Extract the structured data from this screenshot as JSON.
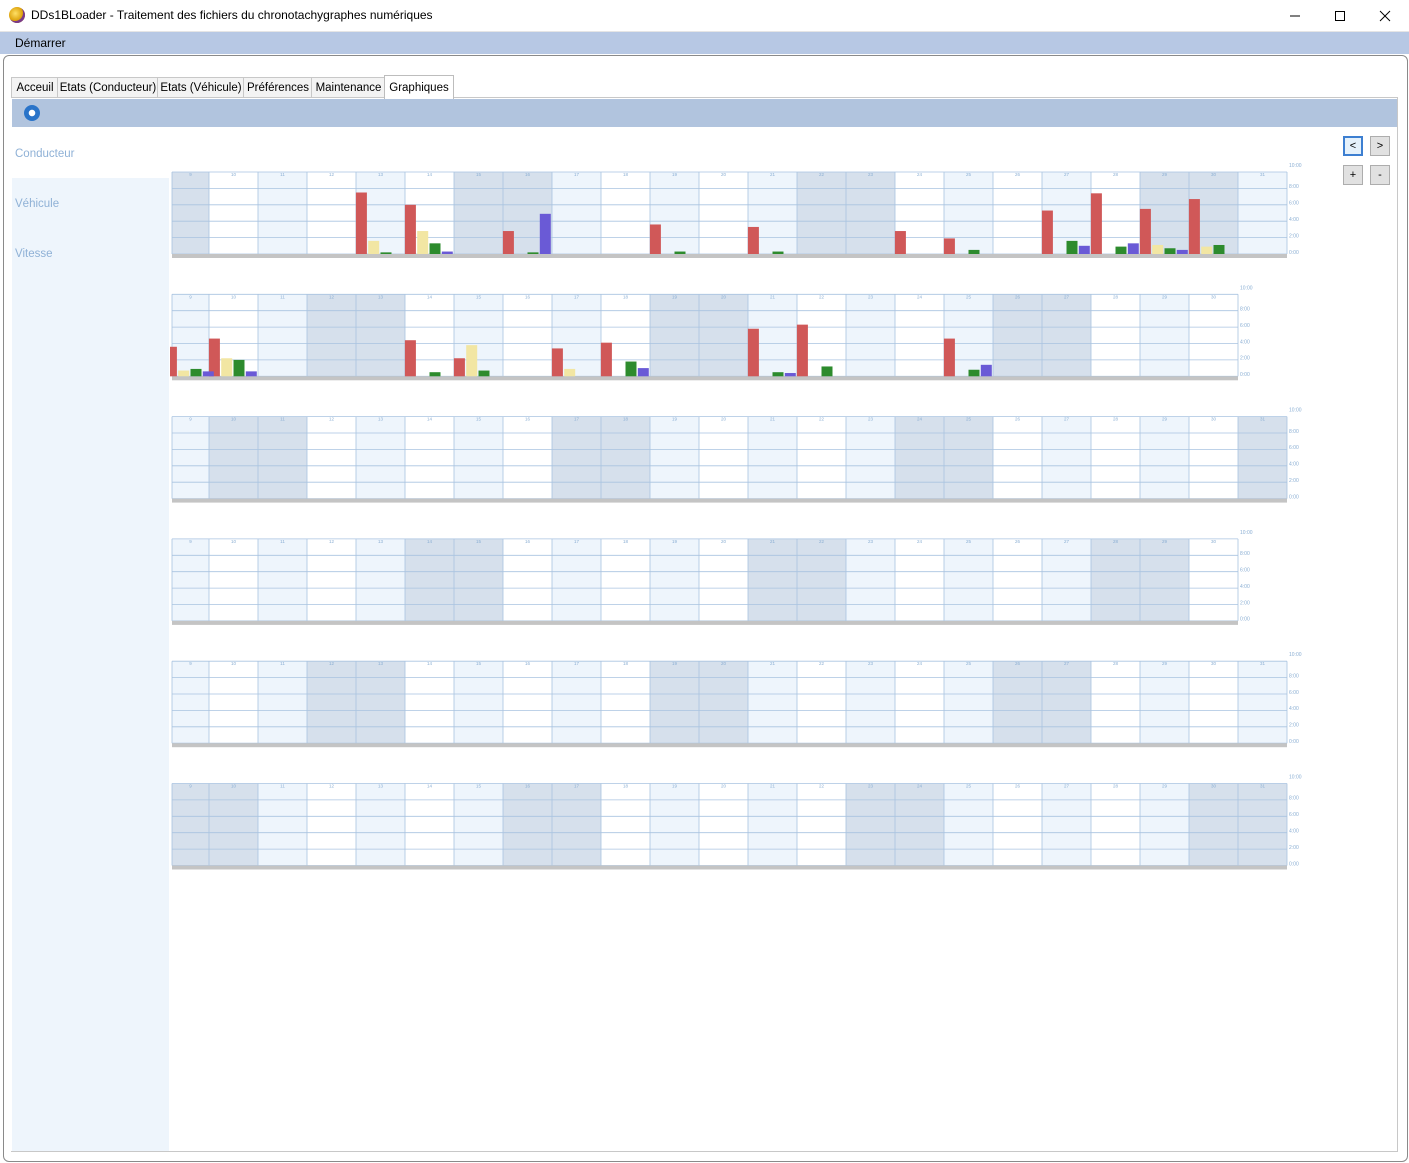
{
  "window": {
    "title": "DDs1BLoader - Traitement des fichiers du chronotachygraphes numériques",
    "minimize_label": "—",
    "maximize_label": "☐",
    "close_label": "✕"
  },
  "menu": {
    "items": [
      "Démarrer"
    ]
  },
  "tabs": [
    {
      "label": "Acceuil"
    },
    {
      "label": "Etats (Conducteur)"
    },
    {
      "label": "Etats (Véhicule)"
    },
    {
      "label": "Préférences"
    },
    {
      "label": "Maintenance"
    },
    {
      "label": "Graphiques",
      "active": true
    }
  ],
  "toolbar": {
    "refresh_icon": "refresh-icon"
  },
  "sidebar": {
    "items": [
      "Conducteur",
      "Véhicule",
      "Vitesse"
    ]
  },
  "nav": {
    "prev_label": "<",
    "next_label": ">",
    "zoom_in_label": "+",
    "zoom_out_label": "-"
  },
  "colors": {
    "conduite": "#d05858",
    "disponibilite": "#f2e6a3",
    "travail": "#2d8b2d",
    "repos": "#6a5ad6",
    "weekend_fill": "#d6e0ec",
    "alt_fill": "#eef5fc",
    "grid": "#a9c3e0",
    "axis_text": "#8aaed3"
  },
  "chart_data": [
    {
      "type": "bar",
      "days": [
        "9",
        "10",
        "11",
        "12",
        "13",
        "14",
        "15",
        "16",
        "17",
        "18",
        "19",
        "20",
        "21",
        "22",
        "23",
        "24",
        "25",
        "26",
        "27",
        "28",
        "29",
        "30",
        "31"
      ],
      "ylim": [
        0,
        10
      ],
      "ytick_labels": [
        "10:00",
        "8:00",
        "6:00",
        "4:00",
        "2:00",
        "0:00"
      ],
      "weekend": [
        0,
        6,
        7,
        13,
        14,
        20,
        21
      ],
      "series": [
        {
          "color": "conduite",
          "values": [
            0,
            0,
            0,
            0,
            7.5,
            6,
            0,
            2.8,
            0,
            0,
            3.6,
            0,
            3.3,
            0,
            0,
            2.8,
            1.9,
            0,
            5.3,
            7.4,
            5.5,
            6.7,
            0,
            0,
            0,
            5.7
          ]
        },
        {
          "color": "disponibilite",
          "values": [
            0,
            0,
            0,
            0,
            1.6,
            2.8,
            0,
            0,
            0,
            0,
            0,
            0,
            0,
            0,
            0,
            0,
            0,
            0,
            0,
            0,
            1.1,
            0.9,
            0,
            0,
            0,
            0.4
          ]
        },
        {
          "color": "travail",
          "values": [
            0,
            0,
            0,
            0,
            0.2,
            1.3,
            0,
            0.2,
            0,
            0,
            0.3,
            0,
            0.3,
            0,
            0,
            0,
            0.5,
            0,
            1.6,
            0.9,
            0.7,
            1.1,
            0,
            0,
            0,
            0.9
          ]
        },
        {
          "color": "repos",
          "values": [
            0,
            0,
            0,
            0,
            0,
            0.3,
            0,
            4.9,
            0,
            0,
            0,
            0,
            0,
            0,
            0,
            0,
            0,
            0,
            1.0,
            1.3,
            0.5,
            0,
            0,
            0,
            0,
            0.4
          ]
        }
      ]
    },
    {
      "type": "bar",
      "days": [
        "9",
        "10",
        "11",
        "12",
        "13",
        "14",
        "15",
        "16",
        "17",
        "18",
        "19",
        "20",
        "21",
        "22",
        "23",
        "24",
        "25",
        "26",
        "27",
        "28",
        "29",
        "30"
      ],
      "ylim": [
        0,
        10
      ],
      "ytick_labels": [
        "10:00",
        "8:00",
        "6:00",
        "4:00",
        "2:00",
        "0:00"
      ],
      "weekend": [
        3,
        4,
        10,
        11,
        17,
        18
      ],
      "series": [
        {
          "color": "conduite",
          "values": [
            3.6,
            4.6,
            0,
            0,
            0,
            4.4,
            2.2,
            0,
            3.4,
            4.1,
            0,
            0,
            5.8,
            6.3,
            0,
            0,
            4.6,
            0,
            0,
            0,
            0,
            0
          ]
        },
        {
          "color": "disponibilite",
          "values": [
            0.7,
            2.2,
            0,
            0,
            0,
            0,
            3.8,
            0,
            0.9,
            0,
            0,
            0,
            0,
            0,
            0,
            0,
            0,
            0,
            0,
            0,
            0,
            0
          ]
        },
        {
          "color": "travail",
          "values": [
            0.9,
            2.0,
            0,
            0,
            0,
            0.5,
            0.7,
            0,
            0,
            1.8,
            0,
            0,
            0.5,
            1.2,
            0,
            0,
            0.8,
            0,
            0,
            0,
            0,
            0
          ]
        },
        {
          "color": "repos",
          "values": [
            0.6,
            0.6,
            0,
            0,
            0,
            0,
            0,
            0,
            0,
            1.0,
            0,
            0,
            0.4,
            0,
            0,
            0,
            1.4,
            0,
            0,
            0,
            0,
            0
          ]
        }
      ]
    },
    {
      "type": "bar",
      "days": [
        "9",
        "10",
        "11",
        "12",
        "13",
        "14",
        "15",
        "16",
        "17",
        "18",
        "19",
        "20",
        "21",
        "22",
        "23",
        "24",
        "25",
        "26",
        "27",
        "28",
        "29",
        "30",
        "31"
      ],
      "ylim": [
        0,
        10
      ],
      "ytick_labels": [
        "10:00",
        "8:00",
        "6:00",
        "4:00",
        "2:00",
        "0:00"
      ],
      "weekend": [
        1,
        2,
        8,
        9,
        15,
        16,
        22
      ],
      "series": []
    },
    {
      "type": "bar",
      "days": [
        "9",
        "10",
        "11",
        "12",
        "13",
        "14",
        "15",
        "16",
        "17",
        "18",
        "19",
        "20",
        "21",
        "22",
        "23",
        "24",
        "25",
        "26",
        "27",
        "28",
        "29",
        "30"
      ],
      "ylim": [
        0,
        10
      ],
      "ytick_labels": [
        "10:00",
        "8:00",
        "6:00",
        "4:00",
        "2:00",
        "0:00"
      ],
      "weekend": [
        5,
        6,
        12,
        13,
        19,
        20
      ],
      "series": []
    },
    {
      "type": "bar",
      "days": [
        "9",
        "10",
        "11",
        "12",
        "13",
        "14",
        "15",
        "16",
        "17",
        "18",
        "19",
        "20",
        "21",
        "22",
        "23",
        "24",
        "25",
        "26",
        "27",
        "28",
        "29",
        "30",
        "31"
      ],
      "ylim": [
        0,
        10
      ],
      "ytick_labels": [
        "10:00",
        "8:00",
        "6:00",
        "4:00",
        "2:00",
        "0:00"
      ],
      "weekend": [
        3,
        4,
        10,
        11,
        17,
        18
      ],
      "series": []
    },
    {
      "type": "bar",
      "days": [
        "9",
        "10",
        "11",
        "12",
        "13",
        "14",
        "15",
        "16",
        "17",
        "18",
        "19",
        "20",
        "21",
        "22",
        "23",
        "24",
        "25",
        "26",
        "27",
        "28",
        "29",
        "30",
        "31"
      ],
      "ylim": [
        0,
        10
      ],
      "ytick_labels": [
        "10:00",
        "8:00",
        "6:00",
        "4:00",
        "2:00",
        "0:00"
      ],
      "weekend": [
        0,
        1,
        7,
        8,
        14,
        15,
        21,
        22
      ],
      "series": []
    }
  ]
}
